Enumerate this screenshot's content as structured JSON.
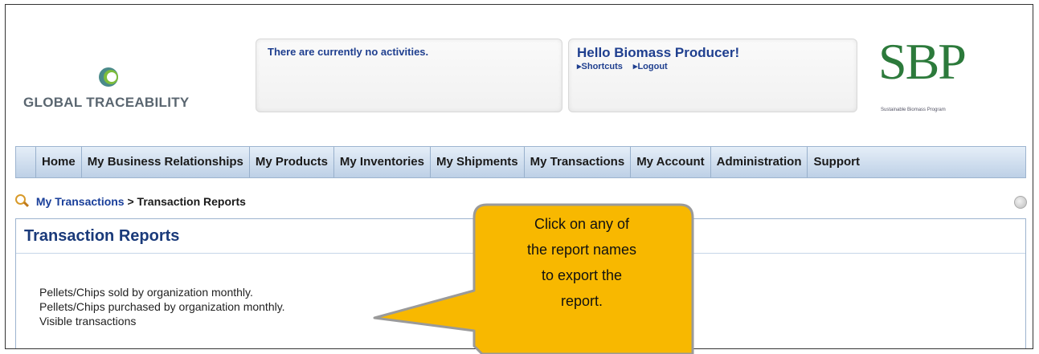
{
  "header": {
    "brand": "GLOBAL TRACEABILITY",
    "activities": "There are currently no activities.",
    "greeting": "Hello Biomass Producer!",
    "links": [
      {
        "label": "▸Shortcuts"
      },
      {
        "label": "▸Logout"
      }
    ],
    "sbp_logo": "SBP",
    "sbp_tagline": "Sustainable Biomass Program"
  },
  "nav": [
    {
      "label": "Home"
    },
    {
      "label": "My Business Relationships"
    },
    {
      "label": "My Products"
    },
    {
      "label": "My Inventories"
    },
    {
      "label": "My Shipments"
    },
    {
      "label": "My Transactions"
    },
    {
      "label": "My Account"
    },
    {
      "label": "Administration"
    },
    {
      "label": "Support"
    }
  ],
  "breadcrumb": {
    "link": "My Transactions",
    "current": "> Transaction Reports"
  },
  "page": {
    "title": "Transaction Reports",
    "reports": [
      "Pellets/Chips sold by organization monthly.",
      "Pellets/Chips purchased by organization monthly.",
      "Visible transactions"
    ]
  },
  "callout": {
    "lines": [
      "Click on any of",
      "the report names",
      "to export the",
      "report."
    ]
  },
  "icons": {
    "logo": "global-traceability-logo",
    "breadcrumb": "magnifier-icon",
    "help": "help-icon"
  },
  "colors": {
    "accent": "#1a3f9a",
    "callout": "#f8b800",
    "nav_bg": "#c9d9ec",
    "sbp_green": "#2c7a3b"
  }
}
